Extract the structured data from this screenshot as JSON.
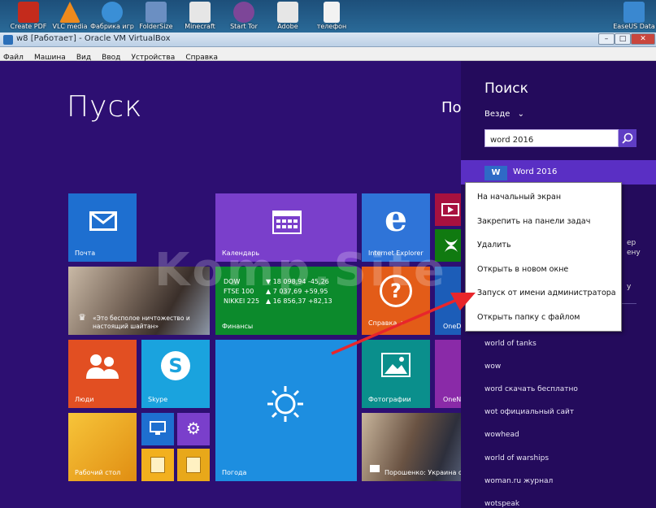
{
  "desktop": {
    "icons": [
      {
        "label": "Create PDF",
        "icon": "pdf-icon",
        "color": "#c42b1c"
      },
      {
        "label": "VLC media",
        "icon": "vlc-icon",
        "color": "#f08a1c"
      },
      {
        "label": "Фабрика игр",
        "icon": "games-factory-icon",
        "color": "#3a8fd6"
      },
      {
        "label": "FolderSize",
        "icon": "foldersize-icon",
        "color": "#6b8fc2"
      },
      {
        "label": "Minecraft",
        "icon": "minecraft-icon",
        "color": "#e6e6e6"
      },
      {
        "label": "Start Tor",
        "icon": "tor-icon",
        "color": "#7d4698"
      },
      {
        "label": "Adobe",
        "icon": "adobe-icon",
        "color": "#e6e6e6"
      },
      {
        "label": "телефон",
        "icon": "text-file-icon",
        "color": "#f2f2f2"
      },
      {
        "label": "EaseUS Data",
        "icon": "easeus-icon",
        "color": "#3a88d0"
      }
    ]
  },
  "window": {
    "title": "w8 [Работает] - Oracle VM VirtualBox",
    "menu": [
      "Файл",
      "Машина",
      "Вид",
      "Ввод",
      "Устройства",
      "Справка"
    ]
  },
  "start": {
    "title": "Пуск",
    "user_fragment": "По",
    "tiles": {
      "mail": {
        "label": "Почта",
        "color": "#1e6fd0",
        "icon": "mail-icon"
      },
      "calendar": {
        "label": "Календарь",
        "color": "#7a3fcb",
        "icon": "calendar-icon"
      },
      "ie": {
        "label": "Internet Explorer",
        "color": "#2f74d8",
        "icon": "internet-explorer-icon"
      },
      "video": {
        "color": "#a8113f",
        "icon": "video-icon"
      },
      "games": {
        "color": "#107a10",
        "icon": "xbox-games-icon"
      },
      "news": {
        "label": "«Это бесполое ничтожество и настоящий шайтан»",
        "icon": "trophy-icon"
      },
      "finance": {
        "label": "Финансы",
        "color": "#0c8a2c",
        "rows": [
          {
            "name": "DOW",
            "value": "▼ 18 098,94 -45,26"
          },
          {
            "name": "FTSE 100",
            "value": "▲ 7 037,69 +59,95"
          },
          {
            "name": "NIKKEI 225",
            "value": "▲ 16 856,37 +82,13"
          }
        ]
      },
      "help": {
        "label": "Справка +",
        "color": "#e35c18",
        "icon": "help-icon"
      },
      "onedrive": {
        "label": "OneD",
        "color": "#1c5db8"
      },
      "people": {
        "label": "Люди",
        "color": "#e24f22",
        "icon": "people-icon"
      },
      "skype": {
        "label": "Skype",
        "color": "#1aa3de",
        "icon": "skype-icon"
      },
      "weather": {
        "label": "Погода",
        "color": "#1d8ee0",
        "icon": "sun-icon"
      },
      "photos": {
        "label": "Фотографии",
        "color": "#0a8f8c",
        "icon": "photos-icon"
      },
      "onenote": {
        "label": "OneN",
        "color": "#8a2aa8"
      },
      "desktop": {
        "label": "Рабочий стол",
        "color": "#f2a51b"
      },
      "pc": {
        "color": "#1e6fd0",
        "icon": "computer-icon"
      },
      "settings": {
        "color": "#7a3fcb",
        "icon": "gear-icon"
      },
      "explorer": {
        "color": "#f2b01e",
        "icon": "folder-icon"
      },
      "explorer2": {
        "color": "#e8a81a",
        "icon": "folder-icon"
      },
      "news2": {
        "label": "Порошенко: Украина с..."
      }
    }
  },
  "watermark": "Komp.Site",
  "search": {
    "title": "Поиск",
    "scope": "Везде",
    "query": "word 2016",
    "top_result": "Word 2016",
    "fragments": [
      "ер",
      "ену",
      "у"
    ],
    "suggestions": [
      "world of tanks",
      "wow",
      "word скачать бесплатно",
      "wot официальный сайт",
      "wowhead",
      "world of warships",
      "woman.ru журнал",
      "wotspeak"
    ]
  },
  "context_menu": {
    "items": [
      "На начальный экран",
      "Закрепить на панели задач",
      "Удалить",
      "Открыть в новом окне",
      "Запуск от имени администратора",
      "Открыть папку с файлом"
    ]
  }
}
